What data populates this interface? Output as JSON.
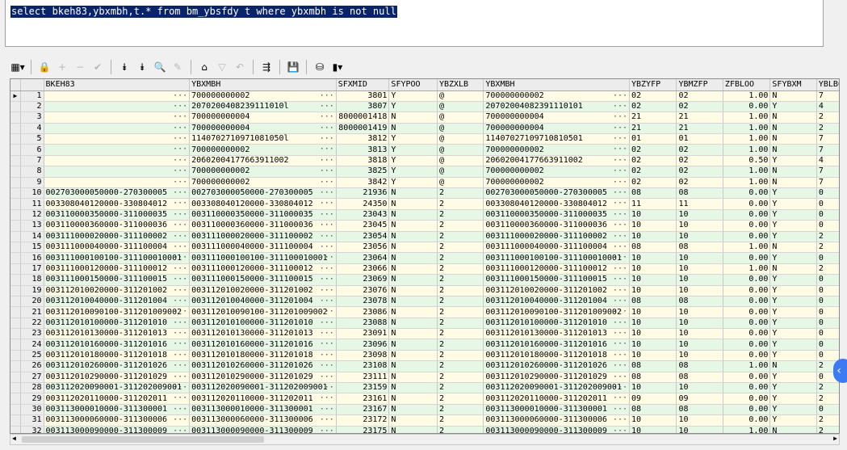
{
  "editor": {
    "sql": "select bkeh83,ybxmbh,t.* from bm_ybsfdy t where ybxmbh is not null"
  },
  "toolbar": [
    {
      "name": "grid-view-icon",
      "glyph": "▦▾",
      "disabled": false
    },
    {
      "sep": true
    },
    {
      "name": "lock-icon",
      "glyph": "🔒",
      "disabled": false
    },
    {
      "name": "add-row-icon",
      "glyph": "+",
      "disabled": true
    },
    {
      "name": "delete-row-icon",
      "glyph": "−",
      "disabled": true
    },
    {
      "name": "post-icon",
      "glyph": "✔",
      "disabled": true
    },
    {
      "sep": true
    },
    {
      "name": "fetch-next-icon",
      "glyph": "⯯",
      "disabled": false
    },
    {
      "name": "fetch-all-icon",
      "glyph": "⯯",
      "disabled": false
    },
    {
      "name": "find-icon",
      "glyph": "🔍",
      "disabled": false
    },
    {
      "name": "clear-icon",
      "glyph": "✎",
      "disabled": true
    },
    {
      "sep": true
    },
    {
      "name": "query-icon",
      "glyph": "⌂",
      "disabled": false
    },
    {
      "name": "filter-icon",
      "glyph": "▽",
      "disabled": true
    },
    {
      "name": "undo-icon",
      "glyph": "↶",
      "disabled": true
    },
    {
      "sep": true
    },
    {
      "name": "export-icon",
      "glyph": "⇶",
      "disabled": false
    },
    {
      "sep": true
    },
    {
      "name": "save-icon",
      "glyph": "💾",
      "disabled": false
    },
    {
      "sep": true
    },
    {
      "name": "database-icon",
      "glyph": "⛁",
      "disabled": false
    },
    {
      "name": "chart-icon",
      "glyph": "▮▾",
      "disabled": false
    }
  ],
  "columns": [
    "BKEH83",
    "YBXMBH",
    "SFXMID",
    "SFYPOO",
    "YBZXLB",
    "YBXMBH",
    "YBZYFP",
    "YBMZFP",
    "ZFBLOO",
    "SFYBXM",
    "YBLBOO"
  ],
  "rows": [
    [
      "1",
      "",
      "700000000002",
      "3801",
      "Y",
      "@",
      "700000000002",
      "02",
      "02",
      "1.00",
      "N",
      "7"
    ],
    [
      "2",
      "",
      "2070200408239111010l",
      "3807",
      "Y",
      "@",
      "20702004082391110101",
      "02",
      "02",
      "0.00",
      "Y",
      "4"
    ],
    [
      "3",
      "",
      "700000000004",
      "8000001418",
      "N",
      "@",
      "700000000004",
      "21",
      "21",
      "1.00",
      "N",
      "2"
    ],
    [
      "4",
      "",
      "700000000004",
      "8000001419",
      "N",
      "@",
      "700000000004",
      "21",
      "21",
      "1.00",
      "N",
      "2"
    ],
    [
      "5",
      "",
      "1140702710971081050l",
      "3812",
      "Y",
      "@",
      "11407027109710810501",
      "01",
      "01",
      "1.00",
      "N",
      "7"
    ],
    [
      "6",
      "",
      "700000000002",
      "3813",
      "Y",
      "@",
      "700000000002",
      "02",
      "02",
      "1.00",
      "N",
      "7"
    ],
    [
      "7",
      "",
      "20602004177663911002",
      "3818",
      "Y",
      "@",
      "20602004177663911002",
      "02",
      "02",
      "0.50",
      "Y",
      "4"
    ],
    [
      "8",
      "",
      "700000000002",
      "3825",
      "Y",
      "@",
      "700000000002",
      "02",
      "02",
      "1.00",
      "N",
      "7"
    ],
    [
      "9",
      "",
      "700000000002",
      "3842",
      "Y",
      "@",
      "700000000002",
      "02",
      "02",
      "1.00",
      "N",
      "7"
    ],
    [
      "10",
      "002703000050000-270300005",
      "002703000050000-270300005",
      "21936",
      "N",
      "2",
      "002703000050000-270300005",
      "08",
      "08",
      "0.00",
      "Y",
      "0"
    ],
    [
      "11",
      "003308040120000-330804012",
      "003308040120000-330804012",
      "24350",
      "N",
      "2",
      "003308040120000-330804012",
      "11",
      "11",
      "0.00",
      "Y",
      "0"
    ],
    [
      "12",
      "003110000350000-311000035",
      "003110000350000-311000035",
      "23043",
      "N",
      "2",
      "003110000350000-311000035",
      "10",
      "10",
      "0.00",
      "Y",
      "0"
    ],
    [
      "13",
      "003110000360000-311000036",
      "003110000360000-311000036",
      "23045",
      "N",
      "2",
      "003110000360000-311000036",
      "10",
      "10",
      "0.00",
      "Y",
      "0"
    ],
    [
      "14",
      "003111000020000-311100002",
      "003111000020000-311100002",
      "23054",
      "N",
      "2",
      "003111000020000-311100002",
      "10",
      "10",
      "0.00",
      "Y",
      "2"
    ],
    [
      "15",
      "003111000040000-311100004",
      "003111000040000-311100004",
      "23056",
      "N",
      "2",
      "003111000040000-311100004",
      "08",
      "08",
      "1.00",
      "N",
      "2"
    ],
    [
      "16",
      "003111000100100-311100010001",
      "003111000100100-311100010001",
      "23064",
      "N",
      "2",
      "003111000100100-311100010001",
      "10",
      "10",
      "0.00",
      "Y",
      "0"
    ],
    [
      "17",
      "003111000120000-311100012",
      "003111000120000-311100012",
      "23066",
      "N",
      "2",
      "003111000120000-311100012",
      "10",
      "10",
      "1.00",
      "N",
      "2"
    ],
    [
      "18",
      "003111000150000-311100015",
      "003111000150000-311100015",
      "23069",
      "N",
      "2",
      "003111000150000-311100015",
      "10",
      "10",
      "0.00",
      "Y",
      "0"
    ],
    [
      "19",
      "003112010020000-311201002",
      "003112010020000-311201002",
      "23076",
      "N",
      "2",
      "003112010020000-311201002",
      "10",
      "10",
      "0.00",
      "Y",
      "0"
    ],
    [
      "20",
      "003112010040000-311201004",
      "003112010040000-311201004",
      "23078",
      "N",
      "2",
      "003112010040000-311201004",
      "08",
      "08",
      "0.00",
      "Y",
      "0"
    ],
    [
      "21",
      "003112010090100-311201009002",
      "003112010090100-311201009002",
      "23086",
      "N",
      "2",
      "003112010090100-311201009002",
      "10",
      "10",
      "0.00",
      "Y",
      "0"
    ],
    [
      "22",
      "003112010100000-311201010",
      "003112010100000-311201010",
      "23088",
      "N",
      "2",
      "003112010100000-311201010",
      "10",
      "10",
      "0.00",
      "Y",
      "0"
    ],
    [
      "23",
      "003112010130000-311201013",
      "003112010130000-311201013",
      "23091",
      "N",
      "2",
      "003112010130000-311201013",
      "10",
      "10",
      "0.00",
      "Y",
      "0"
    ],
    [
      "24",
      "003112010160000-311201016",
      "003112010160000-311201016",
      "23096",
      "N",
      "2",
      "003112010160000-311201016",
      "10",
      "10",
      "0.00",
      "Y",
      "0"
    ],
    [
      "25",
      "003112010180000-311201018",
      "003112010180000-311201018",
      "23098",
      "N",
      "2",
      "003112010180000-311201018",
      "10",
      "10",
      "0.00",
      "Y",
      "0"
    ],
    [
      "26",
      "003112010260000-311201026",
      "003112010260000-311201026",
      "23108",
      "N",
      "2",
      "003112010260000-311201026",
      "08",
      "08",
      "1.00",
      "N",
      "2"
    ],
    [
      "27",
      "003112010290000-311201029",
      "003112010290000-311201029",
      "23111",
      "N",
      "2",
      "003112010290000-311201029",
      "08",
      "08",
      "0.00",
      "Y",
      "0"
    ],
    [
      "28",
      "003112020090001-311202009001",
      "003112020090001-311202009001",
      "23159",
      "N",
      "2",
      "003112020090001-311202009001",
      "10",
      "10",
      "0.00",
      "Y",
      "2"
    ],
    [
      "29",
      "003112020110000-311202011",
      "003112020110000-311202011",
      "23161",
      "N",
      "2",
      "003112020110000-311202011",
      "09",
      "09",
      "0.00",
      "Y",
      "2"
    ],
    [
      "30",
      "003113000010000-311300001",
      "003113000010000-311300001",
      "23167",
      "N",
      "2",
      "003113000010000-311300001",
      "08",
      "08",
      "0.00",
      "Y",
      "0"
    ],
    [
      "31",
      "003113000060000-311300006",
      "003113000060000-311300006",
      "23172",
      "N",
      "2",
      "003113000060000-311300006",
      "10",
      "10",
      "0.00",
      "Y",
      "2"
    ],
    [
      "32",
      "003113000090000-311300009",
      "003113000090000-311300009",
      "23175",
      "N",
      "2",
      "003113000090000-311300009",
      "10",
      "10",
      "1.00",
      "N",
      "2"
    ]
  ]
}
